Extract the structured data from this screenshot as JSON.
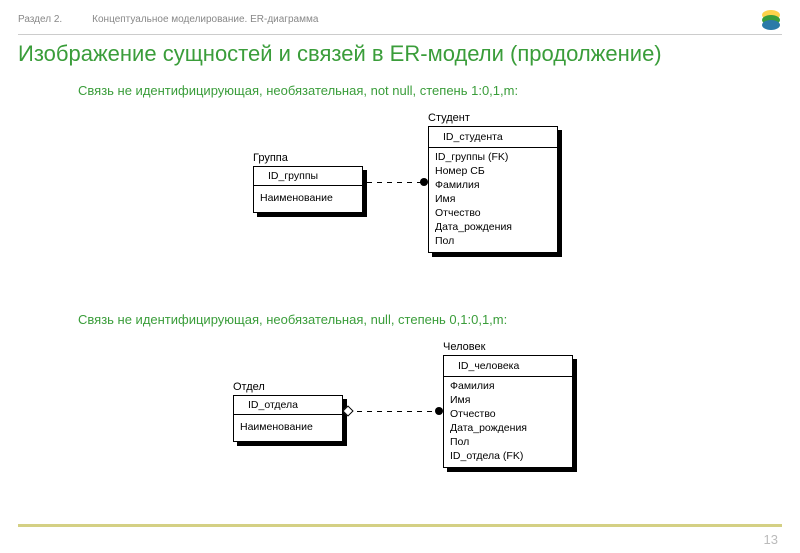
{
  "header": {
    "section": "Раздел 2.",
    "topic": "Концептуальное моделирование. ER-диаграмма"
  },
  "title": "Изображение сущностей и связей в ER-модели (продолжение)",
  "diagram1": {
    "caption": "Связь не идентифицирующая, необязательная, not null, степень 1:0,1,m:",
    "left": {
      "label": "Группа",
      "pk": "ID_группы",
      "attrs": [
        "Наименование"
      ]
    },
    "right": {
      "label": "Студент",
      "pk": "ID_студента",
      "attrs": [
        "ID_группы (FK)",
        "Номер СБ",
        "Фамилия",
        "Имя",
        "Отчество",
        "Дата_рождения",
        "Пол"
      ]
    }
  },
  "diagram2": {
    "caption": "Связь не идентифицирующая, необязательная, null, степень 0,1:0,1,m:",
    "left": {
      "label": "Отдел",
      "pk": "ID_отдела",
      "attrs": [
        "Наименование"
      ]
    },
    "right": {
      "label": "Человек",
      "pk": "ID_человека",
      "attrs": [
        "Фамилия",
        "Имя",
        "Отчество",
        "Дата_рождения",
        "Пол",
        "ID_отдела (FK)"
      ]
    }
  },
  "pageNumber": "13"
}
